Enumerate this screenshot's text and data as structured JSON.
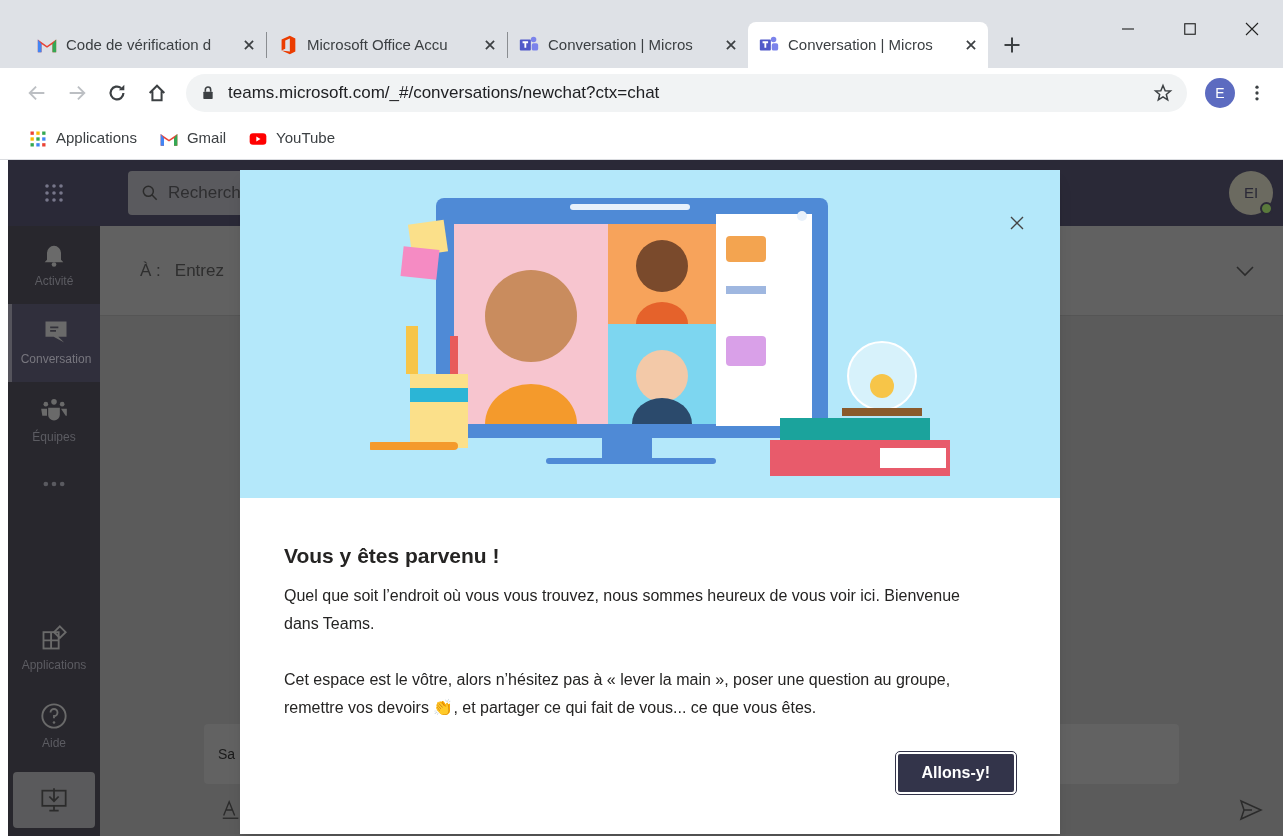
{
  "browser": {
    "tabs": [
      {
        "title": "Code de vérification d",
        "kind": "gmail",
        "selected": false
      },
      {
        "title": "Microsoft Office Accu",
        "kind": "office",
        "selected": false
      },
      {
        "title": "Conversation | Micros",
        "kind": "teams",
        "selected": false
      },
      {
        "title": "Conversation | Micros",
        "kind": "teams",
        "selected": true
      }
    ],
    "address": "teams.microsoft.com/_#/conversations/newchat?ctx=chat",
    "profile": "E",
    "bookmarks": [
      {
        "label": "Applications",
        "kind": "apps"
      },
      {
        "label": "Gmail",
        "kind": "gmail"
      },
      {
        "label": "YouTube",
        "kind": "youtube"
      }
    ]
  },
  "teams": {
    "search": {
      "placeholder": "Recherch"
    },
    "avatar": "EI",
    "rail": [
      {
        "label": "Activité",
        "kind": "bell",
        "selected": false
      },
      {
        "label": "Conversation",
        "kind": "chat",
        "selected": true
      },
      {
        "label": "Équipes",
        "kind": "teams",
        "selected": false
      },
      {
        "label": "Applications",
        "kind": "apps",
        "selected": false
      },
      {
        "label": "Aide",
        "kind": "help",
        "selected": false
      }
    ],
    "to_label": "À :",
    "to_placeholder": "Entrez",
    "compose_placeholder": "Sa"
  },
  "dialog": {
    "title": "Vous y êtes parvenu !",
    "paragraphs": [
      "Quel que soit l’endroit où vous vous trouvez, nous sommes heureux de vous voir ici. Bienvenue dans Teams.",
      "Cet espace est le vôtre, alors n’hésitez pas à « lever la main », poser une question au groupe, remettre vos devoirs 👏, et partager ce qui fait de vous... ce que vous êtes."
    ],
    "button": "Allons-y!"
  }
}
